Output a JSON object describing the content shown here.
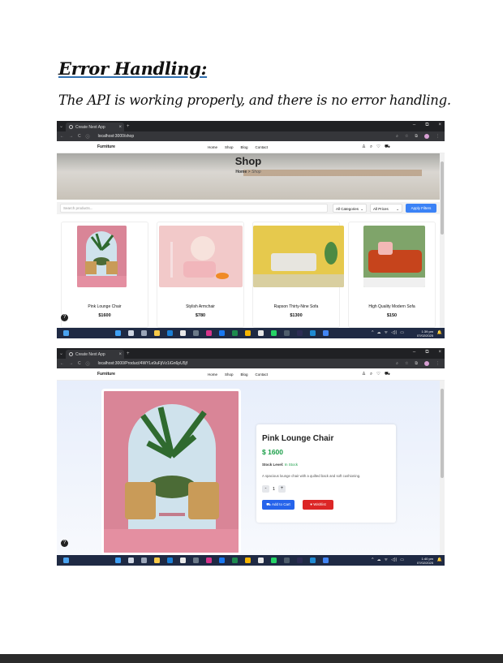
{
  "doc": {
    "heading": "Error Handling:",
    "body": "The API is working properly, and there is no error handling."
  },
  "browser": {
    "tab_title": "Create Next App",
    "new_tab": "+",
    "tab_close": "×",
    "win_min": "–",
    "win_max": "⧉",
    "win_close": "×",
    "back": "←",
    "forward": "→",
    "reload": "C",
    "site_info": "ⓘ",
    "zoom_icon": "⌕",
    "star_icon": "☆",
    "ext_icon": "⧉",
    "menu_icon": "⋮"
  },
  "shop_screen": {
    "url": "localhost:3000/shop",
    "brand": "Furniture",
    "nav": [
      "Home",
      "Shop",
      "Blog",
      "Contact"
    ],
    "nav_icons": [
      "♙",
      "⌕",
      "♡",
      "⛟"
    ],
    "hero_title": "Shop",
    "breadcrumb_home": "Home",
    "breadcrumb_sep": ">",
    "breadcrumb_current": "Shop",
    "search_placeholder": "Search products...",
    "category_select": "All Categories",
    "price_select": "All Prices",
    "chevron": "⌄",
    "apply_label": "Apply Filters",
    "products": [
      {
        "name": "Pink Lounge Chair",
        "price": "$1600"
      },
      {
        "name": "Stylish Armchair",
        "price": "$780"
      },
      {
        "name": "Rapson Thirty-Nine Sofa",
        "price": "$1300"
      },
      {
        "name": "High Quality Modern Sofa",
        "price": "$150"
      }
    ],
    "help_label": "?"
  },
  "product_screen": {
    "url": "localhost:3000/Product/4WYLe9uFjiVz1iGn6pU5jf",
    "brand": "Furniture",
    "nav": [
      "Home",
      "Shop",
      "Blog",
      "Contact"
    ],
    "nav_icons": [
      "♙",
      "⌕",
      "♡",
      "⛟"
    ],
    "product_name": "Pink Lounge Chair",
    "price": "$ 1600",
    "stock_label": "Stock Level:",
    "stock_value": "In Stock",
    "description": "A spacious lounge chair with a quilted back and soft cushioning.",
    "qty_minus": "-",
    "qty_value": "1",
    "qty_plus": "+",
    "cart_icon": "⛟",
    "cart_label": "Add to Cart",
    "wish_icon": "♥",
    "wish_label": "Wishlist",
    "help_label": "?"
  },
  "taskbar": {
    "shop_time": "1:39 pm",
    "shop_date": "07/02/2025",
    "product_time": "1:40 pm",
    "product_date": "07/02/2025",
    "tray_left": "^",
    "tray_icons": [
      "☁",
      "ᯤ",
      "◁))",
      "▭"
    ],
    "bell": "🔔"
  },
  "colors": {
    "accent_blue": "#3b82f6",
    "price_green": "#1a9e48",
    "wishlist_red": "#dc2626",
    "taskbar": "#1f2a44",
    "browser_chrome": "#202124"
  }
}
